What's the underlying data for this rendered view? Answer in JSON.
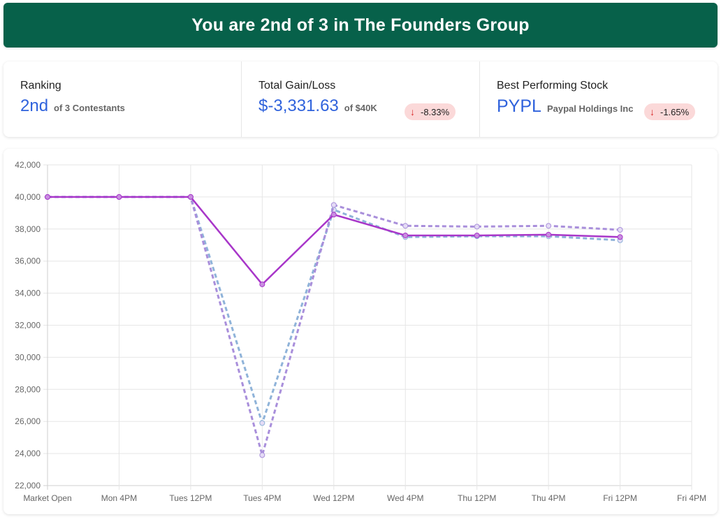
{
  "banner": {
    "title": "You are 2nd of 3 in The Founders Group"
  },
  "stats": {
    "ranking": {
      "label": "Ranking",
      "value": "2nd",
      "sub": "of 3 Contestants"
    },
    "gain": {
      "label": "Total Gain/Loss",
      "value": "$-3,331.63",
      "sub": "of $40K",
      "badge": "-8.33%"
    },
    "best": {
      "label": "Best Performing Stock",
      "ticker": "PYPL",
      "name": "Paypal Holdings Inc",
      "badge": "-1.65%"
    }
  },
  "colors": {
    "banner": "#07614a",
    "accent_blue": "#2f62dc",
    "badge_bg": "#fbd9d9",
    "badge_arrow": "#d92b2b"
  },
  "chart_data": {
    "type": "line",
    "categories": [
      "Market Open",
      "Mon 4PM",
      "Tues 12PM",
      "Tues 4PM",
      "Wed 12PM",
      "Wed 4PM",
      "Thu 12PM",
      "Thu 4PM",
      "Fri 12PM",
      "Fri 4PM"
    ],
    "ylim": [
      22000,
      42000
    ],
    "yticks": [
      "42,000",
      "40,000",
      "38,000",
      "36,000",
      "34,000",
      "32,000",
      "30,000",
      "28,000",
      "26,000",
      "24,000",
      "22,000"
    ],
    "grid": true,
    "series": [
      {
        "color": "#8fb3d9",
        "style": "dashed",
        "values": [
          40000,
          40000,
          40000,
          25900,
          39200,
          37500,
          37550,
          37550,
          37300
        ]
      },
      {
        "color": "#a98fdb",
        "style": "dashed",
        "values": [
          40000,
          40000,
          40000,
          23900,
          39500,
          38200,
          38150,
          38200,
          37950
        ]
      },
      {
        "color": "#a836c9",
        "style": "solid",
        "values": [
          40000,
          40000,
          40000,
          34550,
          38900,
          37600,
          37600,
          37650,
          37500
        ]
      }
    ]
  }
}
